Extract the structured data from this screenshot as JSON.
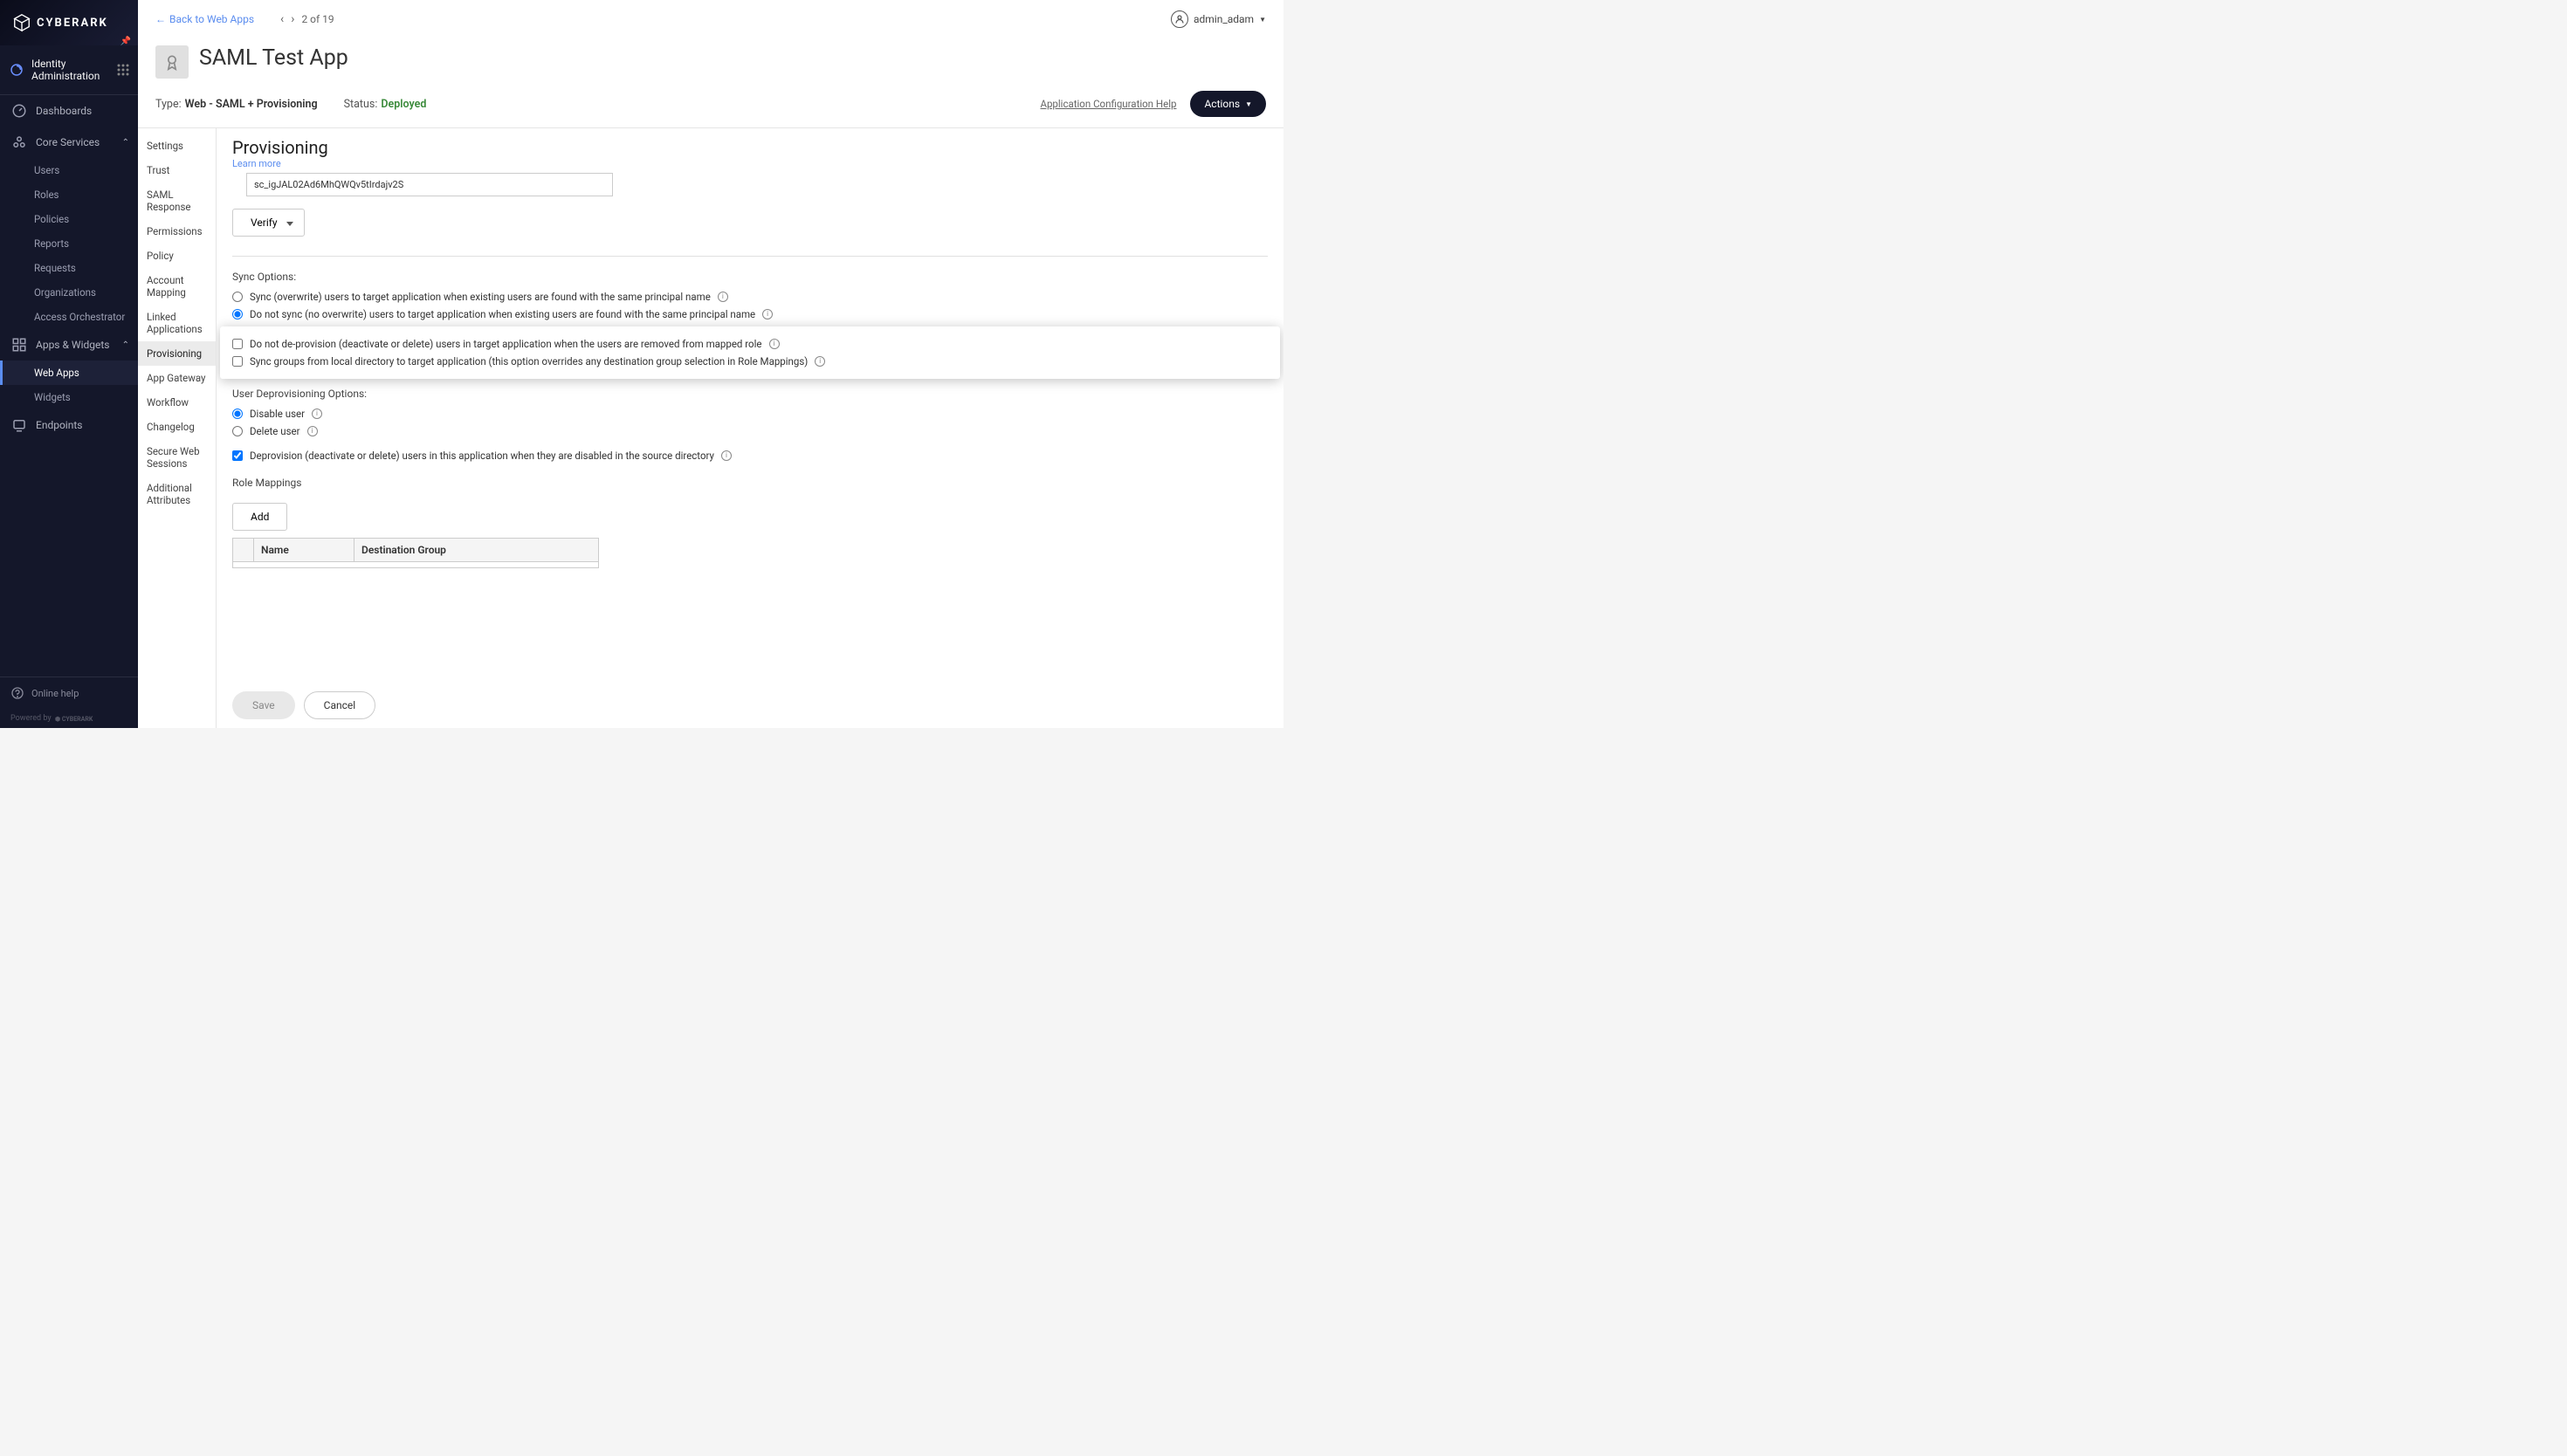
{
  "brand": "CYBERARK",
  "module": "Identity Administration",
  "nav": {
    "dashboards": "Dashboards",
    "core_services": "Core Services",
    "core_items": [
      "Users",
      "Roles",
      "Policies",
      "Reports",
      "Requests",
      "Organizations",
      "Access Orchestrator"
    ],
    "apps_widgets": "Apps & Widgets",
    "apps_items": [
      "Web Apps",
      "Widgets"
    ],
    "endpoints": "Endpoints",
    "online_help": "Online help",
    "powered_by": "Powered by"
  },
  "topbar": {
    "back": "Back to Web Apps",
    "pager": "2 of 19",
    "user": "admin_adam"
  },
  "app": {
    "title": "SAML Test App",
    "type_label": "Type:",
    "type_value": "Web - SAML + Provisioning",
    "status_label": "Status:",
    "status_value": "Deployed",
    "config_help": "Application Configuration Help",
    "actions": "Actions"
  },
  "sub_nav": [
    "Settings",
    "Trust",
    "SAML Response",
    "Permissions",
    "Policy",
    "Account Mapping",
    "Linked Applications",
    "Provisioning",
    "App Gateway",
    "Workflow",
    "Changelog",
    "Secure Web Sessions",
    "Additional Attributes"
  ],
  "panel": {
    "title": "Provisioning",
    "learn_more": "Learn more",
    "token": "sc_igJAL02Ad6MhQWQv5tIrdajv2S",
    "verify": "Verify",
    "sync_options_label": "Sync Options:",
    "sync_overwrite": "Sync (overwrite) users to target application when existing users are found with the same principal name",
    "do_not_sync": "Do not sync (no overwrite) users to target application when existing users are found with the same principal name",
    "do_not_deprovision": "Do not de-provision (deactivate or delete) users in target application when the users are removed from mapped role",
    "sync_groups": "Sync groups from local directory to target application (this option overrides any destination group selection in Role Mappings)",
    "user_deprov_label": "User Deprovisioning Options:",
    "disable_user": "Disable user",
    "delete_user": "Delete user",
    "deprovision": "Deprovision (deactivate or delete) users in this application when they are disabled in the source directory",
    "role_mappings": "Role Mappings",
    "add": "Add",
    "th_name": "Name",
    "th_dest": "Destination Group",
    "save": "Save",
    "cancel": "Cancel"
  }
}
